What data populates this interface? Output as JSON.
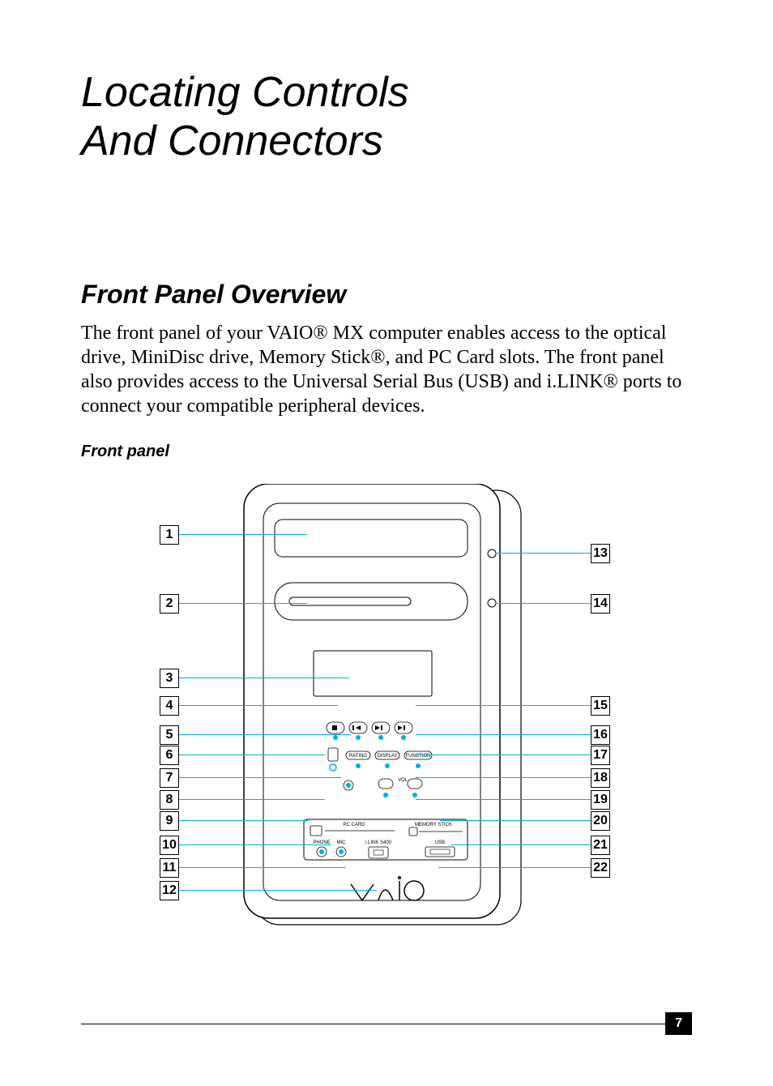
{
  "chapter_title_line1": "Locating Controls",
  "chapter_title_line2": "And Connectors",
  "section_title": "Front Panel Overview",
  "body_paragraph": "The front panel of your VAIO® MX computer enables access to the optical drive, MiniDisc drive, Memory Stick®, and PC Card slots. The front panel also provides access to the Universal Serial Bus (USB) and i.LINK® ports to connect your compatible peripheral devices.",
  "figure_caption": "Front panel",
  "page_number": "7",
  "diagram": {
    "left_callouts": [
      "1",
      "2",
      "3",
      "4",
      "5",
      "6",
      "7",
      "8",
      "9",
      "10",
      "11",
      "12"
    ],
    "right_callouts": [
      "13",
      "14",
      "15",
      "16",
      "17",
      "18",
      "19",
      "20",
      "21",
      "22"
    ],
    "panel_labels": {
      "rating": "RATING",
      "display": "DISPLAY",
      "function": "FUNCTION",
      "vol": "VOL",
      "pc_card": "PC CARD",
      "memory_stick": "MEMORY STICK",
      "phone": "PHONE",
      "mic": "MIC",
      "ilink": "i.LINK S400",
      "usb": "USB",
      "logo": "VAIO"
    }
  }
}
